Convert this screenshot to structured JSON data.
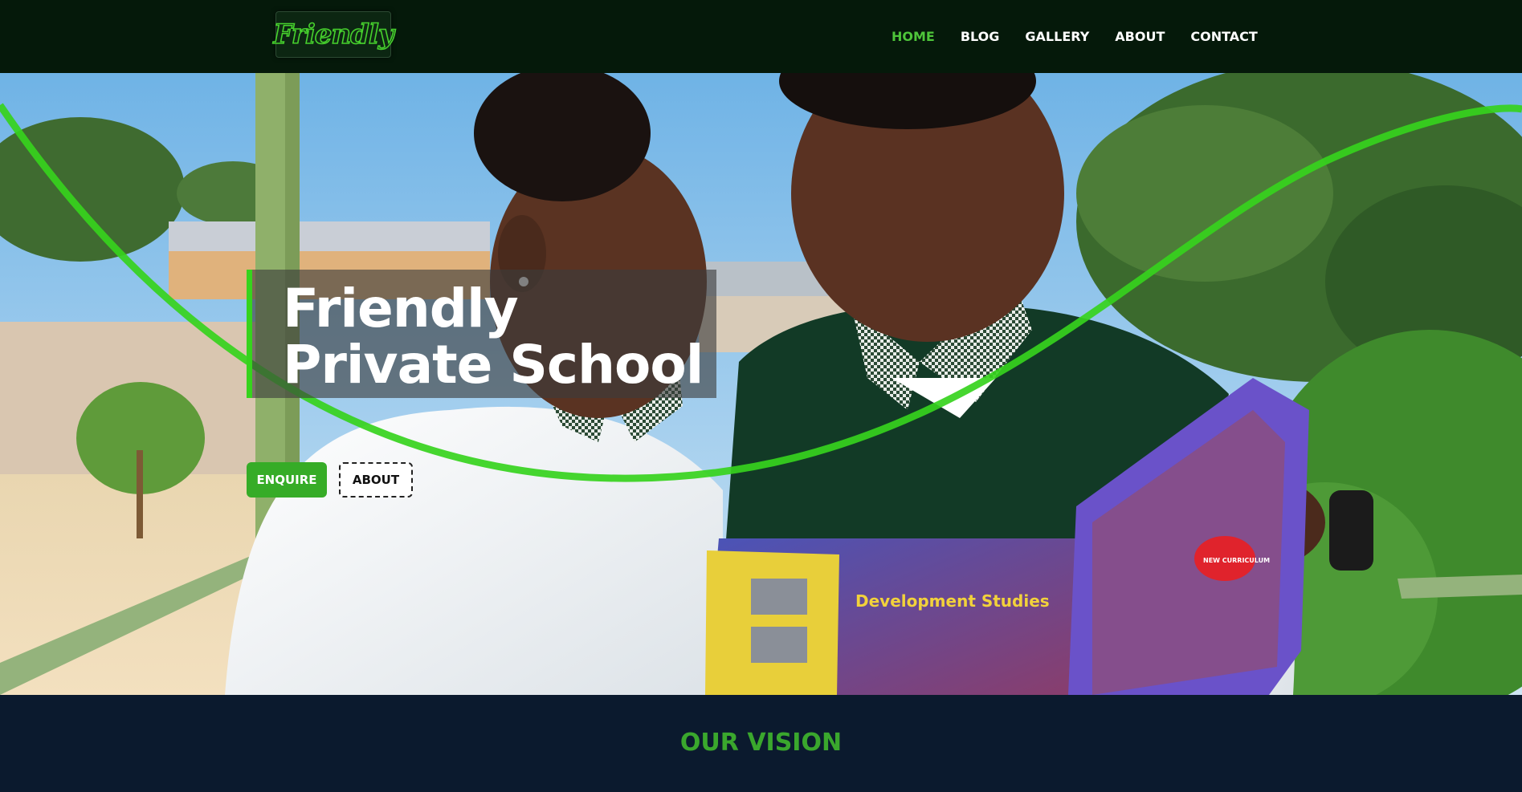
{
  "brand": {
    "logo_text": "Friendly"
  },
  "nav": {
    "items": [
      {
        "label": "HOME",
        "active": true
      },
      {
        "label": "BLOG",
        "active": false
      },
      {
        "label": "GALLERY",
        "active": false
      },
      {
        "label": "ABOUT",
        "active": false
      },
      {
        "label": "CONTACT",
        "active": false
      }
    ]
  },
  "hero": {
    "title": "Friendly Private School",
    "enquire_label": "ENQUIRE",
    "about_label": "ABOUT",
    "book_title": "Development Studies",
    "book_badge": "NEW CURRICULUM",
    "accent_color": "#36d31d"
  },
  "vision": {
    "title": "OUR VISION"
  },
  "colors": {
    "navbar_bg": "#05190a",
    "nav_active": "#4ec53a",
    "footer_bg": "#0b1a2e",
    "vision_title": "#3aa72d"
  }
}
